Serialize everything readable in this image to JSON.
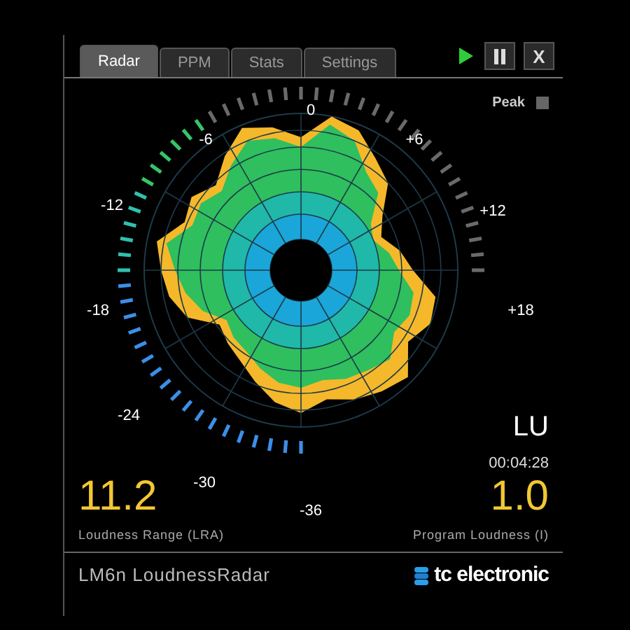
{
  "tabs": [
    {
      "label": "Radar",
      "selected": true
    },
    {
      "label": "PPM",
      "selected": false
    },
    {
      "label": "Stats",
      "selected": false
    },
    {
      "label": "Settings",
      "selected": false
    }
  ],
  "close_label": "X",
  "peak": {
    "label": "Peak",
    "on": false
  },
  "scale_labels": [
    "0",
    "+6",
    "+12",
    "+18",
    "-6",
    "-12",
    "-18",
    "-24",
    "-30",
    "-36"
  ],
  "unit": "LU",
  "time": "00:04:28",
  "readouts": [
    {
      "value": "11.2",
      "label": "Loudness Range (LRA)"
    },
    {
      "value": "1.0",
      "label": "Program Loudness (I)"
    }
  ],
  "footer": {
    "product": "LM6n LoudnessRadar",
    "brand": "tc electronic"
  }
}
